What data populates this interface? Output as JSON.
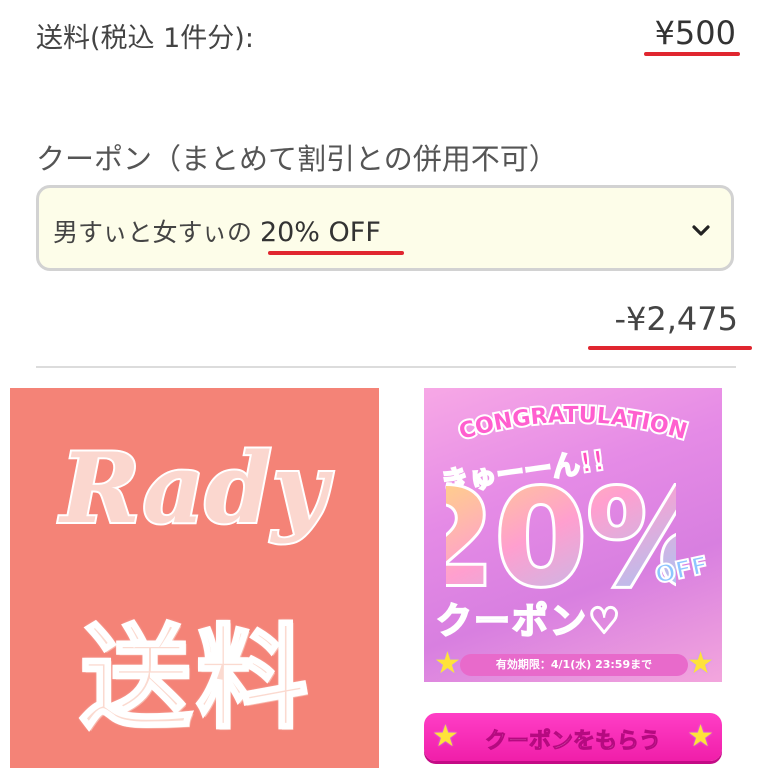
{
  "cart": {
    "shipping_label": "送料(税込 1件分):",
    "shipping_price": "¥500",
    "coupon_heading": "クーポン（まとめて割引との併用不可）",
    "coupon_selected_prefix": "男すぃと女すぃの ",
    "coupon_selected_highlight": "20% OFF",
    "discount_amount": "-¥2,475",
    "highlight_color": "#e0262f"
  },
  "banner_left": {
    "logo_text": "Rady",
    "caption": "送料",
    "background": "#f48377"
  },
  "banner_right": {
    "headline": "CONGRATULATION",
    "burst_text": "きゅーーん!!",
    "discount_number": "20%",
    "off_text": "OFF",
    "coupon_text": "クーポン♡",
    "expiry_text": "有効期限：4/1(水) 23:59まで"
  },
  "action": {
    "get_coupon_label": "クーポンをもらう",
    "button_color": "#f01ea9"
  },
  "icons": {
    "dropdown": "chevron-down-icon",
    "star": "star-icon"
  }
}
